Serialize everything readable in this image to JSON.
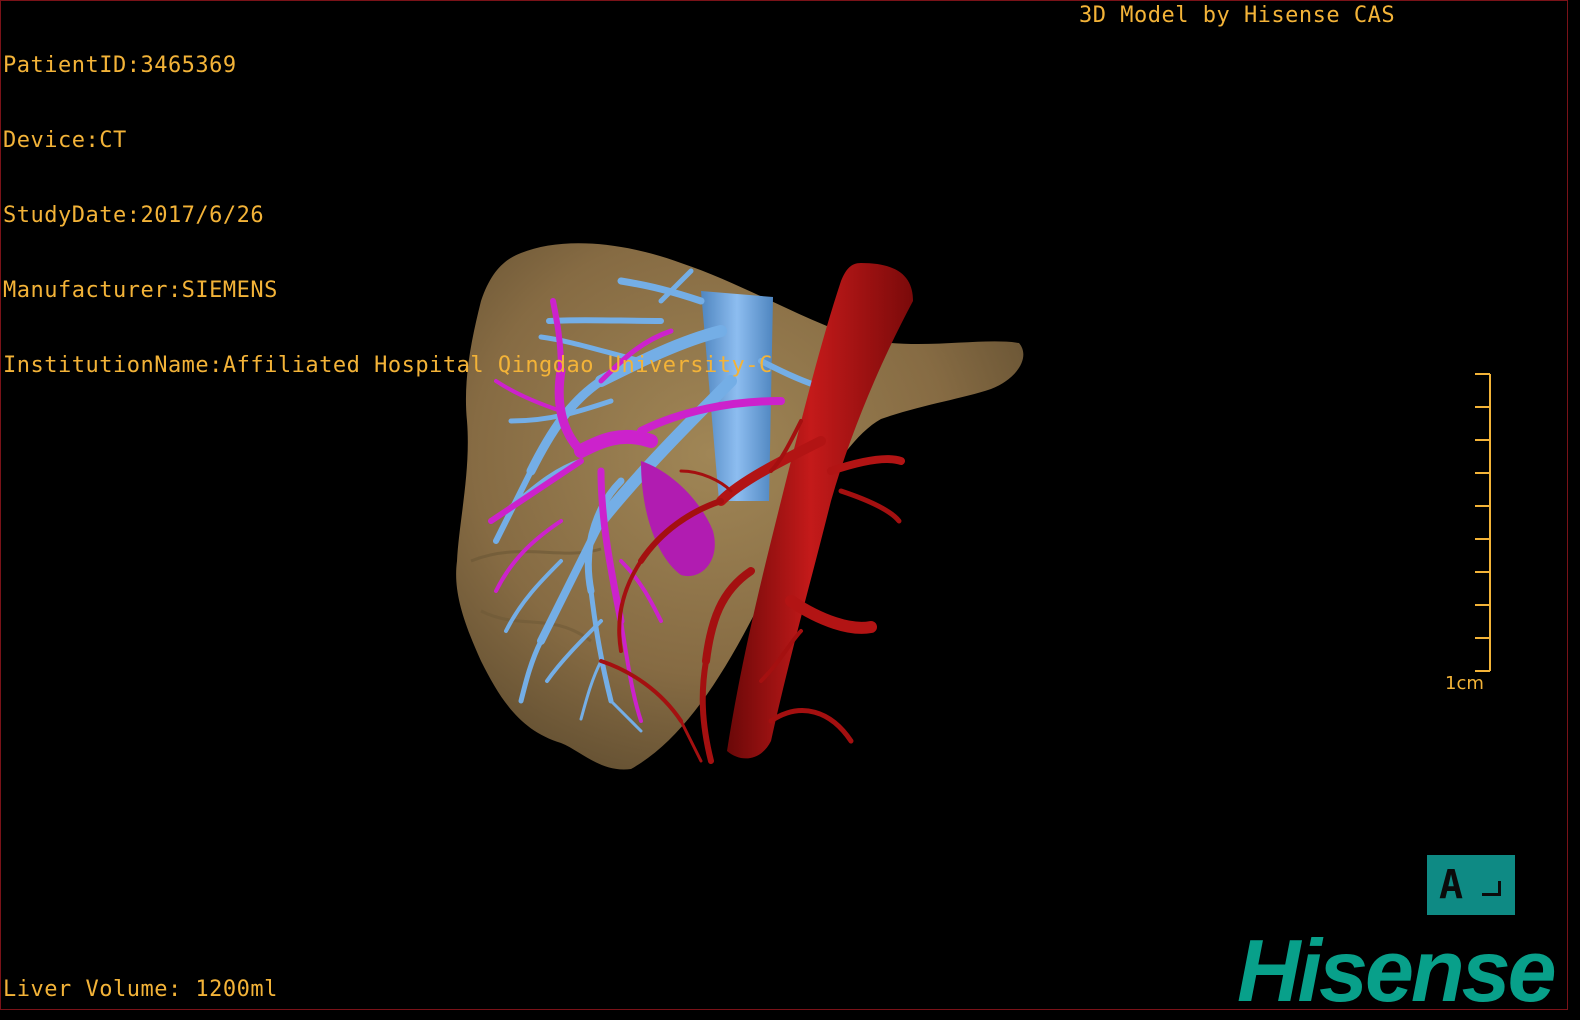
{
  "dicom_info": {
    "patient_id": "PatientID:3465369",
    "device": "Device:CT",
    "study_date": "StudyDate:2017/6/26",
    "manufacturer": "Manufacturer:SIEMENS",
    "institution": "InstitutionName:Affiliated Hospital Qingdao University-C"
  },
  "header": {
    "title": "3D Model by Hisense CAS"
  },
  "footer": {
    "liver_volume": "Liver Volume: 1200ml"
  },
  "scale": {
    "label": "1cm"
  },
  "orientation": {
    "letter": "A"
  },
  "brand": {
    "logo_text": "Hisense"
  },
  "colors": {
    "overlay_text": "#f3b338",
    "liver": "#8a7148",
    "hepatic_vein": "#6fa6de",
    "portal_vein": "#cc1fcc",
    "artery": "#a81010",
    "brand": "#08a08a",
    "border": "#7a1218"
  },
  "model": {
    "structures": [
      "liver-icon",
      "hepatic-vein-icon",
      "portal-vein-icon",
      "aorta-icon"
    ]
  }
}
